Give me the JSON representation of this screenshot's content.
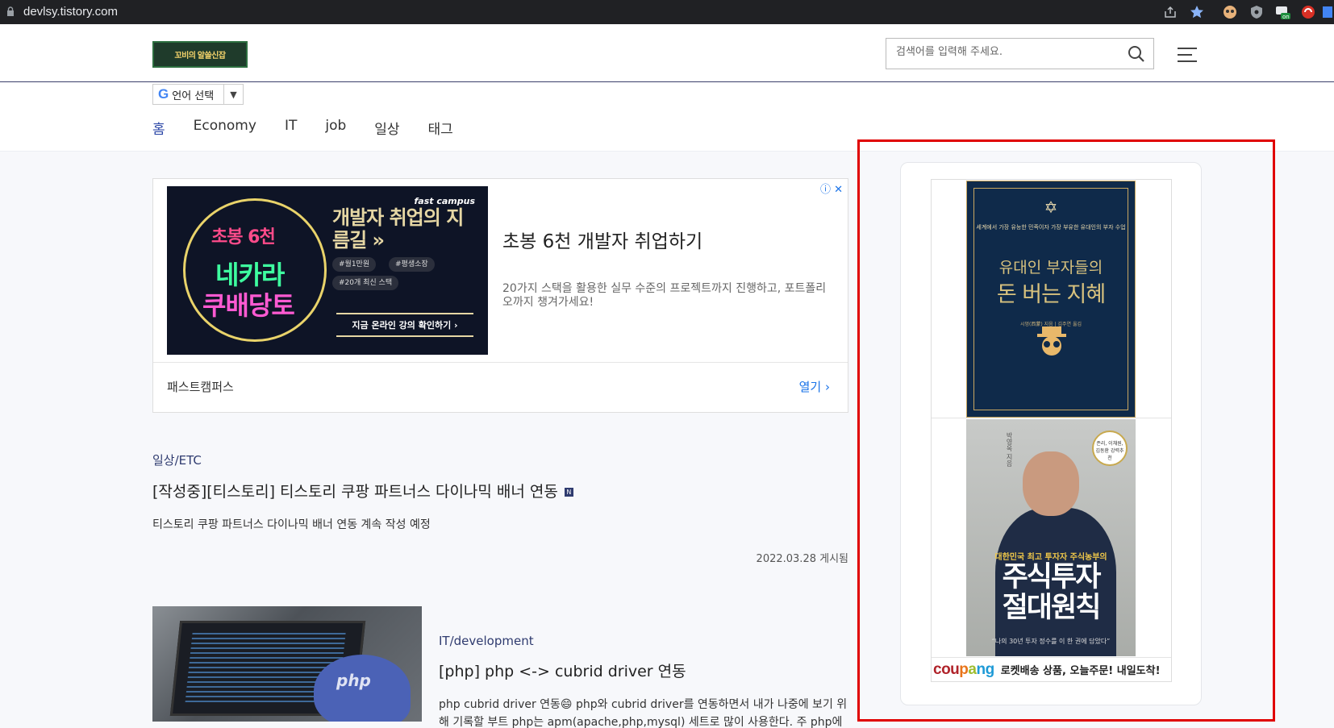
{
  "browser": {
    "url": "devlsy.tistory.com",
    "ext_on_label": "on"
  },
  "header": {
    "logo_text": "꼬비의 알쓸신잡",
    "search_placeholder": "검색어를 입력해 주세요."
  },
  "translate": {
    "g": "G",
    "label": "언어 선택",
    "arrow": "▼"
  },
  "nav": {
    "items": [
      "홈",
      "Economy",
      "IT",
      "job",
      "일상",
      "태그"
    ]
  },
  "ad": {
    "brand": "fast campus",
    "banner_l1": "초봉 6천",
    "banner_l2": "네카라",
    "banner_l3": "쿠배당토",
    "banner_headline": "개발자 취업의 지름길 »",
    "pill1": "#월1만원",
    "pill2": "#평생소장",
    "pill3": "#20개 최신 스택",
    "cta": "지금 온라인 강의 확인하기 ›",
    "title": "초봉 6천 개발자 취업하기",
    "description": "20가지 스택을 활용한 실무 수준의 프로젝트까지 진행하고, 포트폴리오까지 챙겨가세요!",
    "advertiser": "패스트캠퍼스",
    "open_label": "열기 ›",
    "adchoices": "ⓘ ✕"
  },
  "posts": [
    {
      "category": "일상/ETC",
      "title": "[작성중][티스토리] 티스토리 쿠팡 파트너스 다이나믹 배너 연동",
      "new_badge": "N",
      "summary": "티스토리 쿠팡 파트너스 다이나믹 배너 연동 계속 작성 예정",
      "date": "2022.03.28 게시됨"
    },
    {
      "category": "IT/development",
      "title": "[php] php <-> cubrid driver 연동",
      "summary": "php cubrid driver 연동😄 php와 cubrid driver를 연동하면서 내가 나중에 보기 위해 기록할 부트 php는 apm(apache,php,mysql) 세트로 많이 사용한다. 주 php에서",
      "image_text": "php"
    }
  ],
  "coupang": {
    "book1": {
      "star": "✡",
      "subtitle": "세계에서 가장 유능한 민족이자 가장 부유한 유대인의 부자 수업",
      "title1": "유대인 부자들의",
      "title2": "돈 버는 지혜",
      "author": "시멍(西蒙) 지음 | 김주연 옮김"
    },
    "book2": {
      "badge": "존리, 이채원, 김동환 강력추천",
      "vertical_author": "박영옥 지음",
      "kicker": "대한민국 최고 투자자 주식농부의",
      "title1": "주식투자",
      "title2": "절대원칙",
      "quote": "“나의 30년 투자 정수를 이 한 권에 담았다”"
    },
    "logo": {
      "c1": "cou",
      "c2": "p",
      "c3": "a",
      "c4": "ng"
    },
    "tagline": "로켓배송 상품, 오늘주문! 내일도착!"
  }
}
